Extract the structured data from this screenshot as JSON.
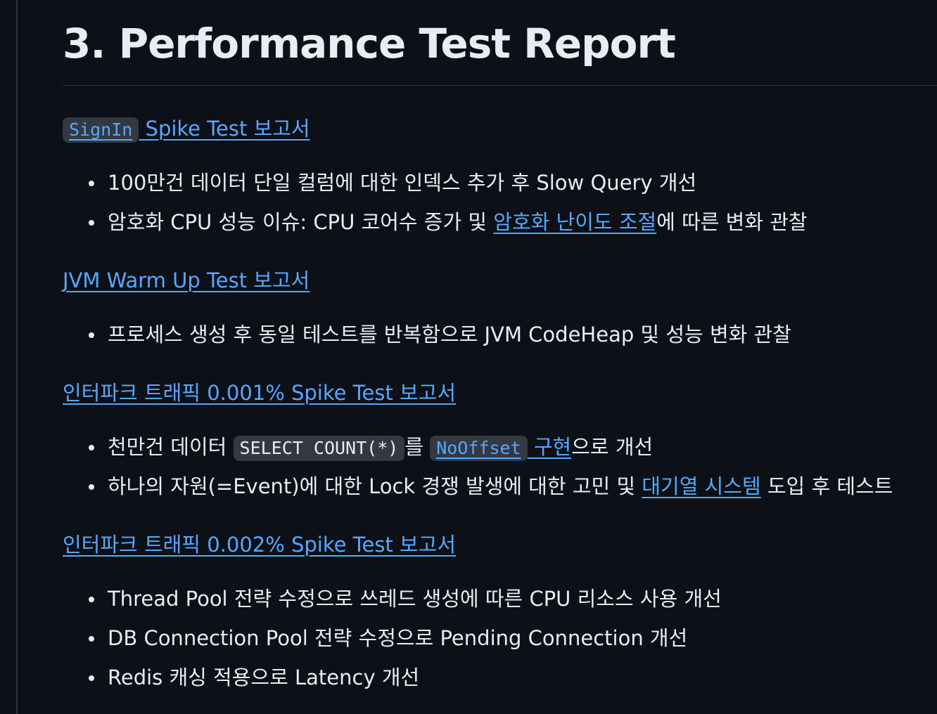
{
  "heading": "3. Performance Test Report",
  "sections": [
    {
      "code": "SignIn",
      "link_text": " Spike Test 보고서",
      "bullets": [
        {
          "text": "100만건 데이터 단일 컬럼에 대한 인덱스 추가 후 Slow Query 개선"
        },
        {
          "pre": "암호화 CPU 성능 이슈: CPU 코어수 증가 및 ",
          "link": "암호화 난이도 조절",
          "post": "에 따른 변화 관찰"
        }
      ]
    },
    {
      "link_text": "JVM Warm Up Test 보고서",
      "bullets": [
        {
          "text": "프로세스 생성 후 동일 테스트를 반복함으로 JVM CodeHeap 및 성능 변화 관찰"
        }
      ]
    },
    {
      "link_text": "인터파크 트래픽 0.001% Spike Test 보고서",
      "bullets": [
        {
          "pre": "천만건 데이터 ",
          "code": "SELECT COUNT(*)",
          "mid": "를 ",
          "link_code": "NoOffset",
          "link": " 구현",
          "post": "으로 개선"
        },
        {
          "pre": "하나의 자원(=Event)에 대한 Lock 경쟁 발생에 대한 고민 및 ",
          "link": "대기열 시스템",
          "post": " 도입 후 테스트"
        }
      ]
    },
    {
      "link_text": "인터파크 트래픽 0.002% Spike Test 보고서",
      "bullets": [
        {
          "text": "Thread Pool 전략 수정으로 쓰레드 생성에 따른 CPU 리소스 사용 개선"
        },
        {
          "text": "DB Connection Pool 전략 수정으로 Pending Connection 개선"
        },
        {
          "text": "Redis 캐싱 적용으로 Latency 개선"
        }
      ]
    }
  ],
  "colors": {
    "background": "#0d1117",
    "text": "#e6edf3",
    "link": "#58a6ff",
    "code_bg": "#343941",
    "rule": "#30363d"
  }
}
